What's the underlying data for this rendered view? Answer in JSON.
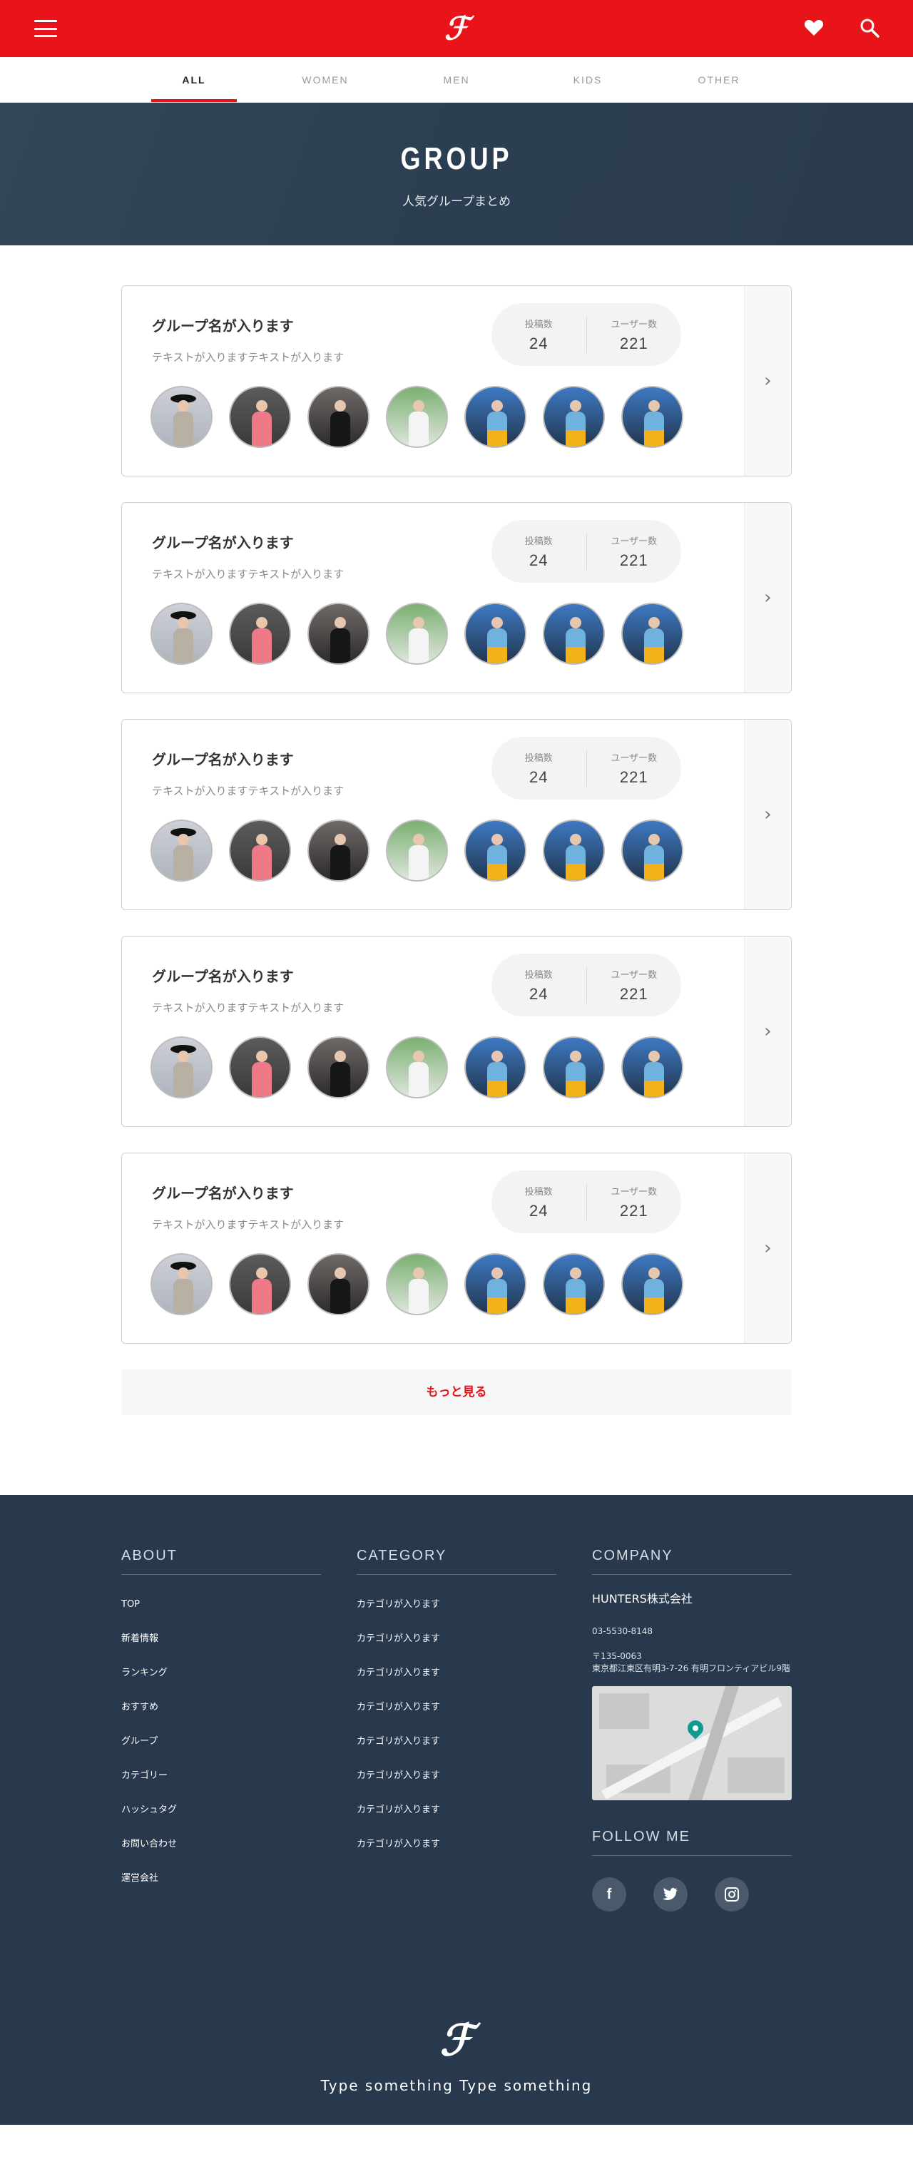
{
  "header": {
    "logo": "ℱ",
    "menu_icon": "hamburger-icon",
    "favorite_icon": "heart-icon",
    "search_icon": "search-icon"
  },
  "tabs": [
    {
      "label": "ALL",
      "active": true
    },
    {
      "label": "WOMEN",
      "active": false
    },
    {
      "label": "MEN",
      "active": false
    },
    {
      "label": "KIDS",
      "active": false
    },
    {
      "label": "OTHER",
      "active": false
    }
  ],
  "hero": {
    "title": "GROUP",
    "subtitle": "人気グループまとめ"
  },
  "groups": [
    {
      "name": "グループ名が入ります",
      "desc": "テキストが入りますテキストが入ります",
      "posts_label": "投稿数",
      "posts": "24",
      "users_label": "ユーザー数",
      "users": "221"
    },
    {
      "name": "グループ名が入ります",
      "desc": "テキストが入りますテキストが入ります",
      "posts_label": "投稿数",
      "posts": "24",
      "users_label": "ユーザー数",
      "users": "221"
    },
    {
      "name": "グループ名が入ります",
      "desc": "テキストが入りますテキストが入ります",
      "posts_label": "投稿数",
      "posts": "24",
      "users_label": "ユーザー数",
      "users": "221"
    },
    {
      "name": "グループ名が入ります",
      "desc": "テキストが入りますテキストが入ります",
      "posts_label": "投稿数",
      "posts": "24",
      "users_label": "ユーザー数",
      "users": "221"
    },
    {
      "name": "グループ名が入ります",
      "desc": "テキストが入りますテキストが入ります",
      "posts_label": "投稿数",
      "posts": "24",
      "users_label": "ユーザー数",
      "users": "221"
    }
  ],
  "more_label": "もっと見る",
  "footer": {
    "about": {
      "heading": "ABOUT",
      "items": [
        "TOP",
        "新着情報",
        "ランキング",
        "おすすめ",
        "グループ",
        "カテゴリー",
        "ハッシュタグ",
        "お問い合わせ",
        "運営会社"
      ]
    },
    "category": {
      "heading": "CATEGORY",
      "items": [
        "カテゴリが入ります",
        "カテゴリが入ります",
        "カテゴリが入ります",
        "カテゴリが入ります",
        "カテゴリが入ります",
        "カテゴリが入ります",
        "カテゴリが入ります",
        "カテゴリが入ります"
      ]
    },
    "company": {
      "heading": "COMPANY",
      "name": "HUNTERS株式会社",
      "tel": "03-5530-8148",
      "postal": "〒135-0063",
      "address": "東京都江東区有明3-7-26 有明フロンティアビル9階"
    },
    "follow": {
      "heading": "FOLLOW ME",
      "icons": [
        "facebook-icon",
        "twitter-icon",
        "instagram-icon"
      ]
    },
    "logo": "ℱ",
    "tagline": "Type something Type something"
  },
  "colors": {
    "brand_red": "#e8141a",
    "navy": "#28384d"
  }
}
